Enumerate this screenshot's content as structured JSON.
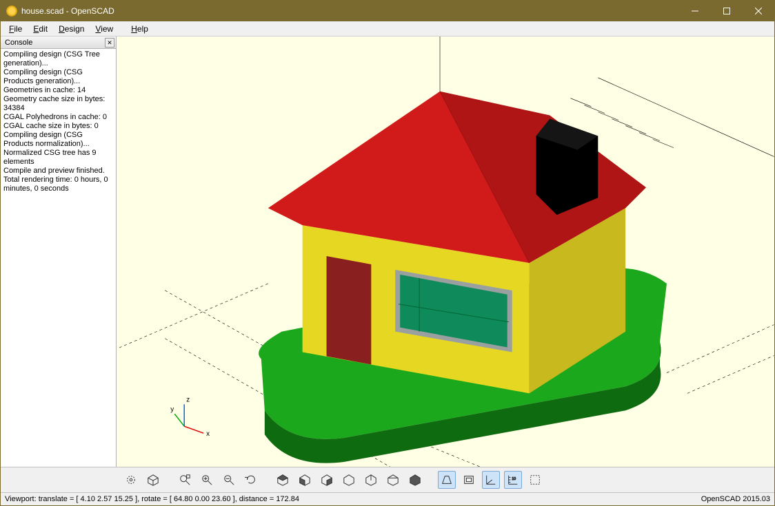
{
  "titlebar": {
    "title": "house.scad - OpenSCAD"
  },
  "menu": {
    "file": "File",
    "edit": "Edit",
    "design": "Design",
    "view": "View",
    "help": "Help"
  },
  "console": {
    "header": "Console",
    "text": "Compiling design (CSG Tree generation)...\nCompiling design (CSG Products generation)...\nGeometries in cache: 14\nGeometry cache size in bytes: 34384\nCGAL Polyhedrons in cache: 0\nCGAL cache size in bytes: 0\nCompiling design (CSG Products normalization)...\nNormalized CSG tree has 9 elements\nCompile and preview finished.\nTotal rendering time: 0 hours, 0 minutes, 0 seconds"
  },
  "statusbar": {
    "left": "Viewport: translate = [ 4.10 2.57 15.25 ], rotate = [ 64.80 0.00 23.60 ], distance = 172.84",
    "right": "OpenSCAD 2015.03"
  },
  "colors": {
    "viewport_bg": "#ffffe5",
    "roof": "#d11a1a",
    "wall_front": "#e6d822",
    "wall_side": "#c7b91e",
    "door": "#8a1f1f",
    "window": "#0f8a5a",
    "window_frame": "#9aa0a0",
    "chimney": "#000000",
    "lawn_top": "#1ca81c",
    "lawn_side": "#0f6b0f"
  },
  "axes": {
    "x": "x",
    "y": "y",
    "z": "z"
  }
}
